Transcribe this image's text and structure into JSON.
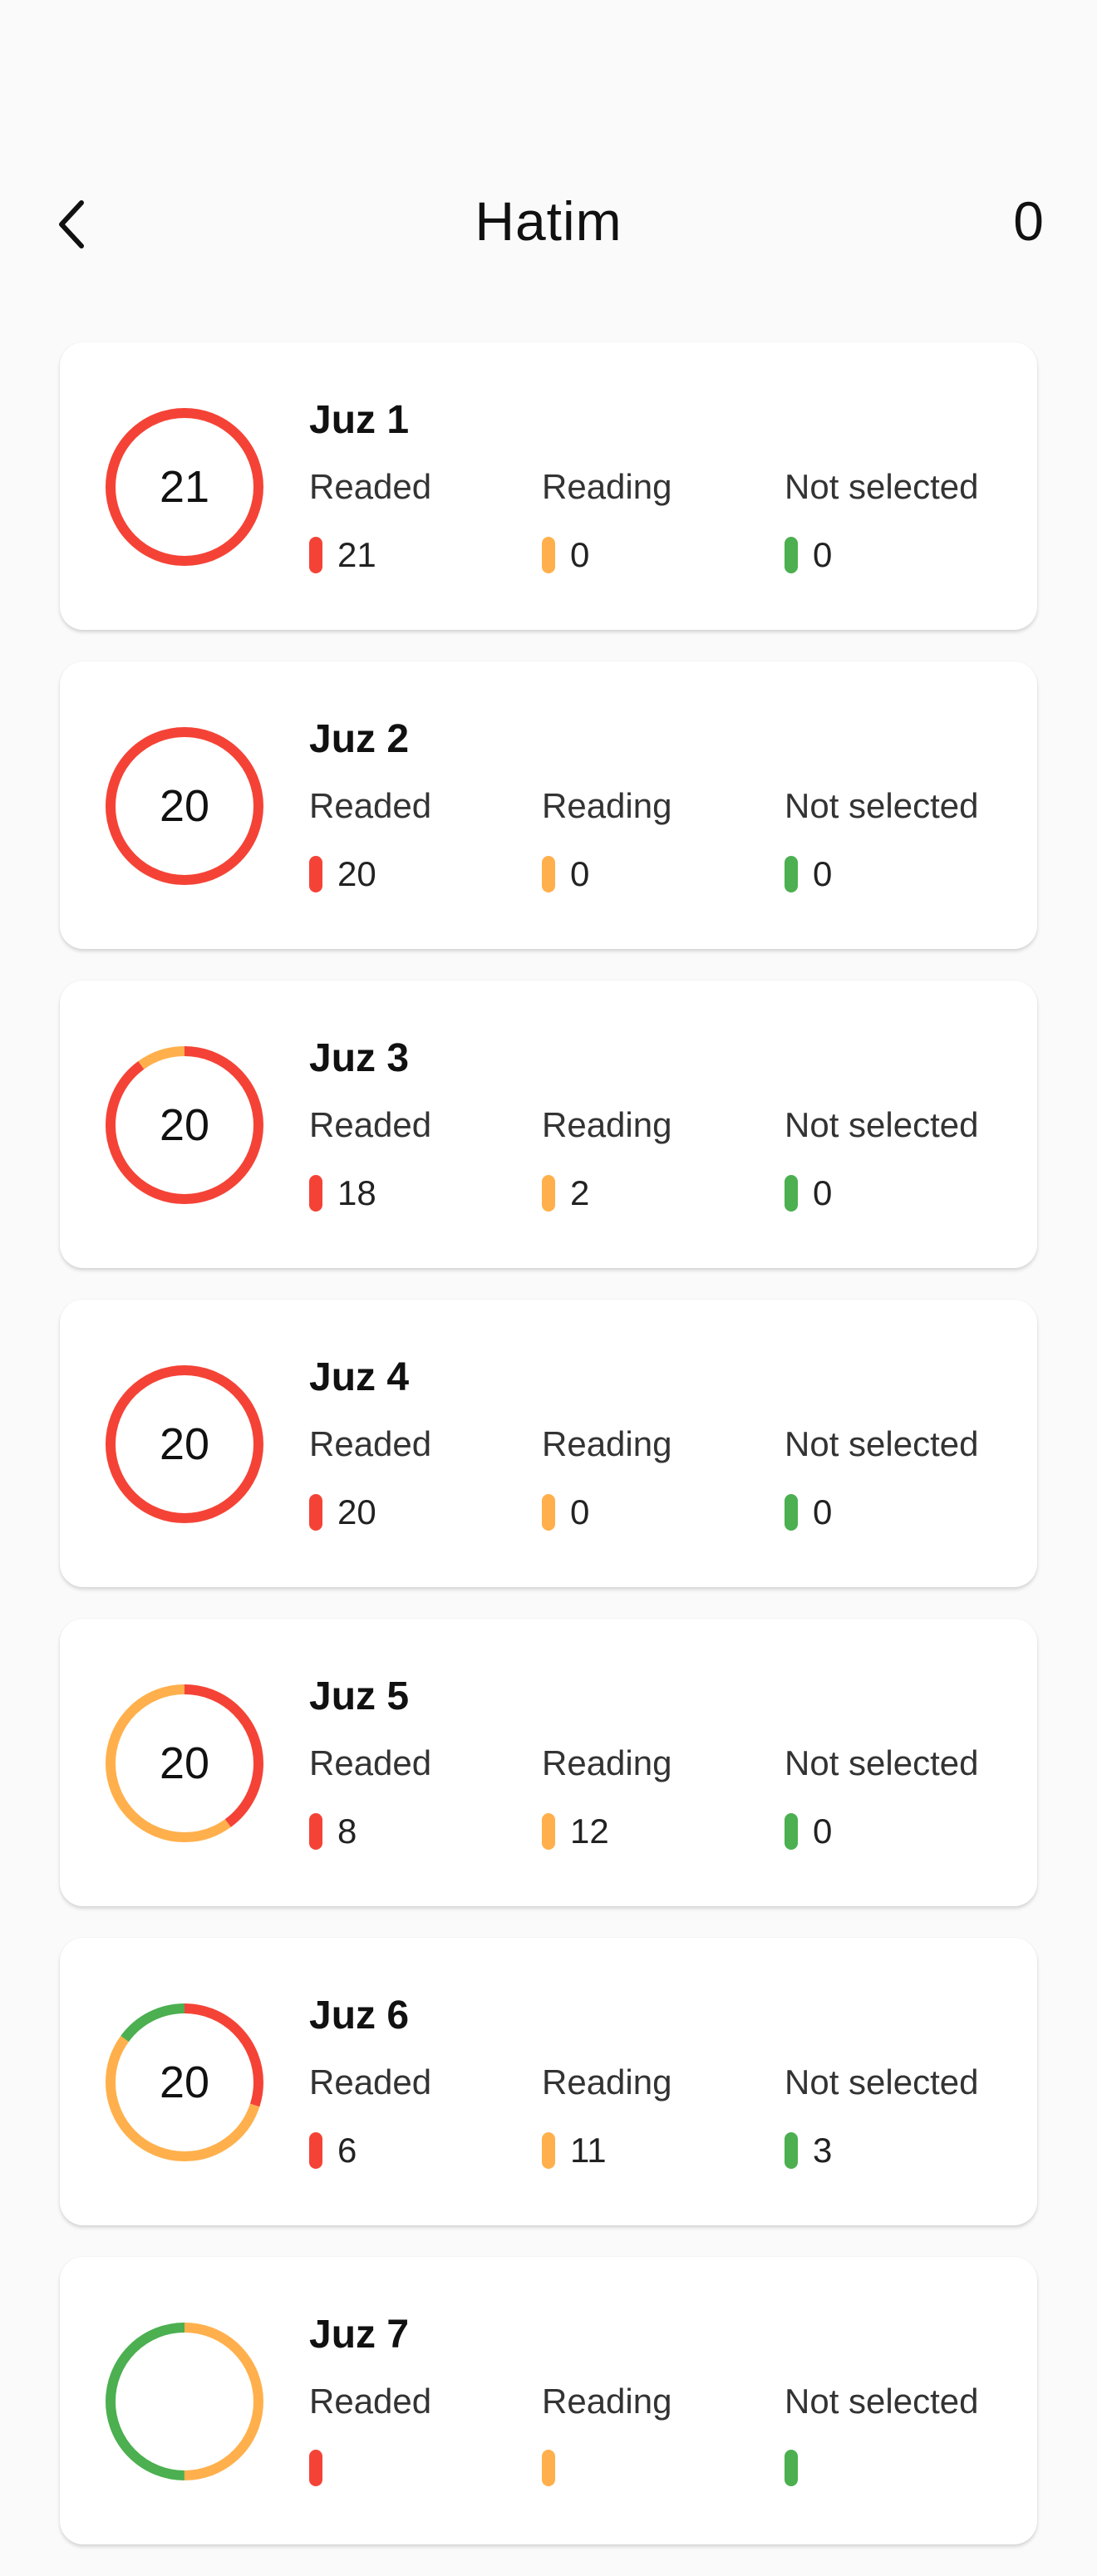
{
  "header": {
    "title": "Hatim",
    "count": "0"
  },
  "colors": {
    "readed": "#f44336",
    "reading": "#ffb04c",
    "not_selected": "#4caf50"
  },
  "labels": {
    "readed": "Readed",
    "reading": "Reading",
    "not_selected": "Not selected"
  },
  "juz": [
    {
      "title": "Juz 1",
      "total": "21",
      "readed": "21",
      "reading": "0",
      "not_selected": "0"
    },
    {
      "title": "Juz 2",
      "total": "20",
      "readed": "20",
      "reading": "0",
      "not_selected": "0"
    },
    {
      "title": "Juz 3",
      "total": "20",
      "readed": "18",
      "reading": "2",
      "not_selected": "0"
    },
    {
      "title": "Juz 4",
      "total": "20",
      "readed": "20",
      "reading": "0",
      "not_selected": "0"
    },
    {
      "title": "Juz 5",
      "total": "20",
      "readed": "8",
      "reading": "12",
      "not_selected": "0"
    },
    {
      "title": "Juz 6",
      "total": "20",
      "readed": "6",
      "reading": "11",
      "not_selected": "3"
    },
    {
      "title": "Juz 7",
      "total": "",
      "readed": "",
      "reading": "",
      "not_selected": "",
      "ring": {
        "readed": 0,
        "reading": 10,
        "not_selected": 10
      }
    }
  ]
}
